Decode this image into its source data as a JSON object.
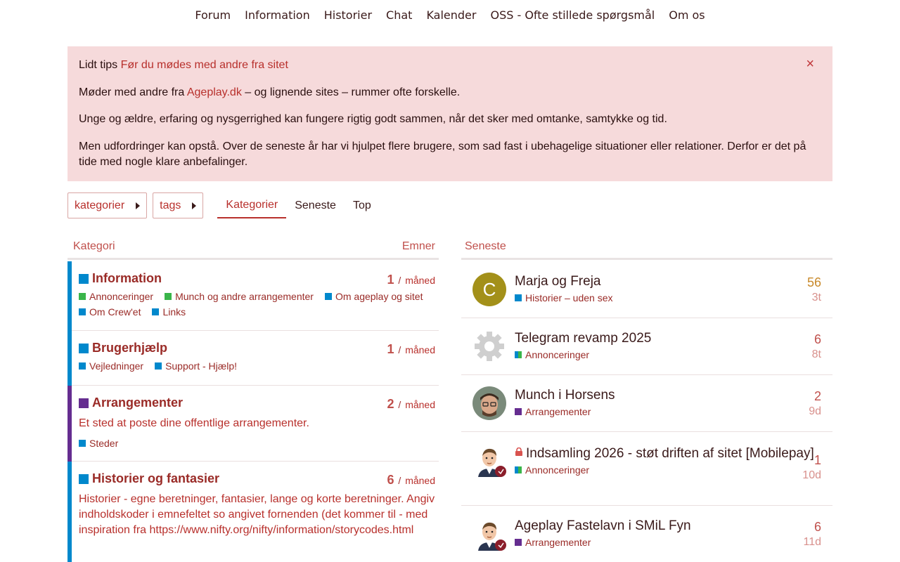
{
  "nav": [
    "Forum",
    "Information",
    "Historier",
    "Chat",
    "Kalender",
    "OSS - Ofte stillede spørgsmål",
    "Om os"
  ],
  "banner": {
    "intro": "Lidt tips",
    "intro_link": "Før du mødes med andre fra sitet",
    "p1_before": "Møder med andre fra",
    "p1_link": "Ageplay.dk",
    "p1_after": "– og lignende sites – rummer ofte forskelle.",
    "p2": "Unge og ældre, erfaring og nysgerrighed kan fungere rigtig godt sammen, når det sker med omtanke, samtykke og tid.",
    "p3": "Men udfordringer kan opstå. Over de seneste år har vi hjulpet flere brugere, som sad fast i ubehagelige situationer eller relationer. Derfor er det på tide med nogle klare anbefalinger.",
    "close_icon": "×"
  },
  "filters": {
    "categories": "kategorier",
    "tags": "tags"
  },
  "tabs": [
    "Kategorier",
    "Seneste",
    "Top"
  ],
  "cat_header": {
    "category": "Kategori",
    "topics": "Emner"
  },
  "latest_header": "Seneste",
  "categories": [
    {
      "name": "Information",
      "color": "#0088cc",
      "count": "1",
      "period": "måned",
      "description": "",
      "subs": [
        {
          "name": "Annonceringer",
          "color": "#3ab54a"
        },
        {
          "name": "Munch og andre arrangementer",
          "color": "#3ab54a"
        },
        {
          "name": "Om ageplay og sitet",
          "color": "#0088cc"
        },
        {
          "name": "Om Crew'et",
          "color": "#0088cc"
        },
        {
          "name": "Links",
          "color": "#0088cc"
        }
      ]
    },
    {
      "name": "Brugerhjælp",
      "color": "#0088cc",
      "count": "1",
      "period": "måned",
      "description": "",
      "subs": [
        {
          "name": "Vejledninger",
          "color": "#0088cc"
        },
        {
          "name": "Support - Hjælp!",
          "color": "#0088cc"
        }
      ]
    },
    {
      "name": "Arrangementer",
      "color": "#652d90",
      "count": "2",
      "period": "måned",
      "description": "Et sted at poste dine offentlige arrangementer.",
      "subs": [
        {
          "name": "Steder",
          "color": "#0088cc"
        }
      ]
    },
    {
      "name": "Historier og fantasier",
      "color": "#0088cc",
      "count": "6",
      "period": "måned",
      "description": "Historier - egne beretninger, fantasier, lange og korte beretninger. Angiv indholdskoder i emnefeltet so angivet fornenden (det kommer til - med inspiration fra https://www.nifty.org/nifty/information/storycodes.html",
      "subs": []
    }
  ],
  "topics": [
    {
      "title": "Marja og Freja",
      "category": "Historier – uden sex",
      "cat_color": "#0088cc",
      "split": false,
      "replies": "56",
      "hot": true,
      "age": "3t",
      "avatar": "letter",
      "avatar_letter": "C",
      "locked": false
    },
    {
      "title": "Telegram revamp 2025",
      "category": "Annonceringer",
      "cat_color": "#3ab54a",
      "split": true,
      "replies": "6",
      "hot": false,
      "age": "8t",
      "avatar": "gear-avatar",
      "locked": false
    },
    {
      "title": "Munch i Horsens",
      "category": "Arrangementer",
      "cat_color": "#652d90",
      "split": false,
      "replies": "2",
      "hot": false,
      "age": "9d",
      "avatar": "photo-avatar",
      "locked": false
    },
    {
      "title": "Indsamling 2026 - støt driften af sitet [Mobilepay]",
      "category": "Annonceringer",
      "cat_color": "#3ab54a",
      "split": true,
      "replies": "1",
      "hot": false,
      "age": "10d",
      "avatar": "cartoon-avatar",
      "locked": true
    },
    {
      "title": "Ageplay Fastelavn i SMiL Fyn",
      "category": "Arrangementer",
      "cat_color": "#652d90",
      "split": false,
      "replies": "6",
      "hot": false,
      "age": "11d",
      "avatar": "cartoon-avatar",
      "locked": false
    }
  ]
}
